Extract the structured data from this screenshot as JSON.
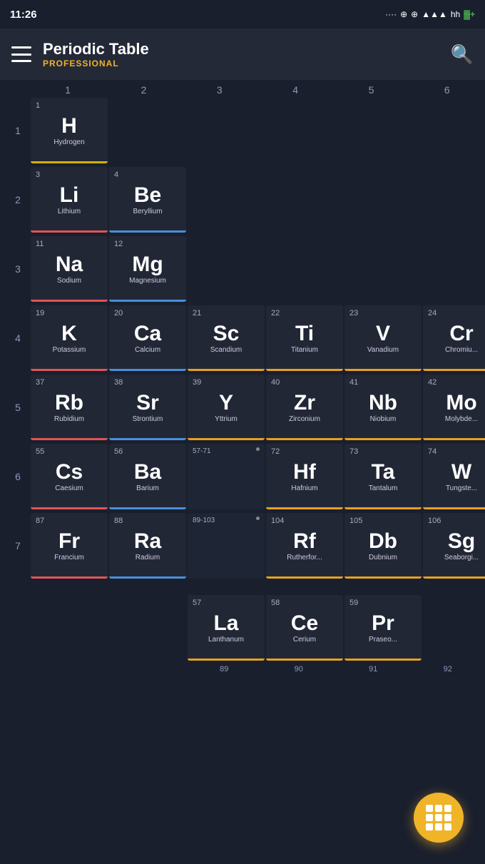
{
  "statusBar": {
    "time": "11:26",
    "icons": ".... ⊕ ⊕ .al hh +"
  },
  "header": {
    "title": "Periodic Table",
    "subtitle": "PROFESSIONAL",
    "hamburgerLabel": "menu",
    "searchLabel": "search"
  },
  "colHeaders": [
    "1",
    "2",
    "3",
    "4",
    "5",
    "6"
  ],
  "rowNumbers": [
    "1",
    "2",
    "3",
    "4",
    "5",
    "6",
    "7"
  ],
  "elements": {
    "H": {
      "num": "1",
      "symbol": "H",
      "name": "Hydrogen",
      "line": "yellow"
    },
    "Li": {
      "num": "3",
      "symbol": "Li",
      "name": "Lithium",
      "line": "red"
    },
    "Be": {
      "num": "4",
      "symbol": "Be",
      "name": "Beryllium",
      "line": "blue"
    },
    "Na": {
      "num": "11",
      "symbol": "Na",
      "name": "Sodium",
      "line": "red"
    },
    "Mg": {
      "num": "12",
      "symbol": "Mg",
      "name": "Magnesium",
      "line": "blue"
    },
    "K": {
      "num": "19",
      "symbol": "K",
      "name": "Potassium",
      "line": "red"
    },
    "Ca": {
      "num": "20",
      "symbol": "Ca",
      "name": "Calcium",
      "line": "blue"
    },
    "Sc": {
      "num": "21",
      "symbol": "Sc",
      "name": "Scandium",
      "line": "orange"
    },
    "Ti": {
      "num": "22",
      "symbol": "Ti",
      "name": "Titanium",
      "line": "orange"
    },
    "V": {
      "num": "23",
      "symbol": "V",
      "name": "Vanadium",
      "line": "orange"
    },
    "Cr": {
      "num": "24",
      "symbol": "Cr",
      "name": "Chromiu...",
      "line": "orange"
    },
    "Rb": {
      "num": "37",
      "symbol": "Rb",
      "name": "Rubidium",
      "line": "red"
    },
    "Sr": {
      "num": "38",
      "symbol": "Sr",
      "name": "Strontium",
      "line": "blue"
    },
    "Y": {
      "num": "39",
      "symbol": "Y",
      "name": "Yttrium",
      "line": "orange"
    },
    "Zr": {
      "num": "40",
      "symbol": "Zr",
      "name": "Zirconium",
      "line": "orange"
    },
    "Nb": {
      "num": "41",
      "symbol": "Nb",
      "name": "Niobium",
      "line": "orange"
    },
    "Mo": {
      "num": "42",
      "symbol": "Mo",
      "name": "Molybde...",
      "line": "orange"
    },
    "Cs": {
      "num": "55",
      "symbol": "Cs",
      "name": "Caesium",
      "line": "red"
    },
    "Ba": {
      "num": "56",
      "symbol": "Ba",
      "name": "Barium",
      "line": "blue"
    },
    "Hf": {
      "num": "72",
      "symbol": "Hf",
      "name": "Hafnium",
      "line": "orange"
    },
    "Ta": {
      "num": "73",
      "symbol": "Ta",
      "name": "Tantalum",
      "line": "orange"
    },
    "W": {
      "num": "74",
      "symbol": "W",
      "name": "Tungste...",
      "line": "orange"
    },
    "Fr": {
      "num": "87",
      "symbol": "Fr",
      "name": "Francium",
      "line": "red"
    },
    "Ra": {
      "num": "88",
      "symbol": "Ra",
      "name": "Radium",
      "line": "blue"
    },
    "Rf": {
      "num": "104",
      "symbol": "Rf",
      "name": "Rutherfor...",
      "line": "orange"
    },
    "Db": {
      "num": "105",
      "symbol": "Db",
      "name": "Dubnium",
      "line": "orange"
    },
    "Sg": {
      "num": "106",
      "symbol": "Sg",
      "name": "Seaborgi...",
      "line": "orange"
    },
    "La": {
      "num": "57",
      "symbol": "La",
      "name": "Lanthanum",
      "line": "orange"
    },
    "Ce": {
      "num": "58",
      "symbol": "Ce",
      "name": "Cerium",
      "line": "orange"
    },
    "Pr": {
      "num": "59",
      "symbol": "Pr",
      "name": "Praseo...",
      "line": "orange"
    }
  },
  "rangeLabels": {
    "57-71": "57-71",
    "89-103": "89-103"
  },
  "fab": {
    "label": "grid-view"
  }
}
